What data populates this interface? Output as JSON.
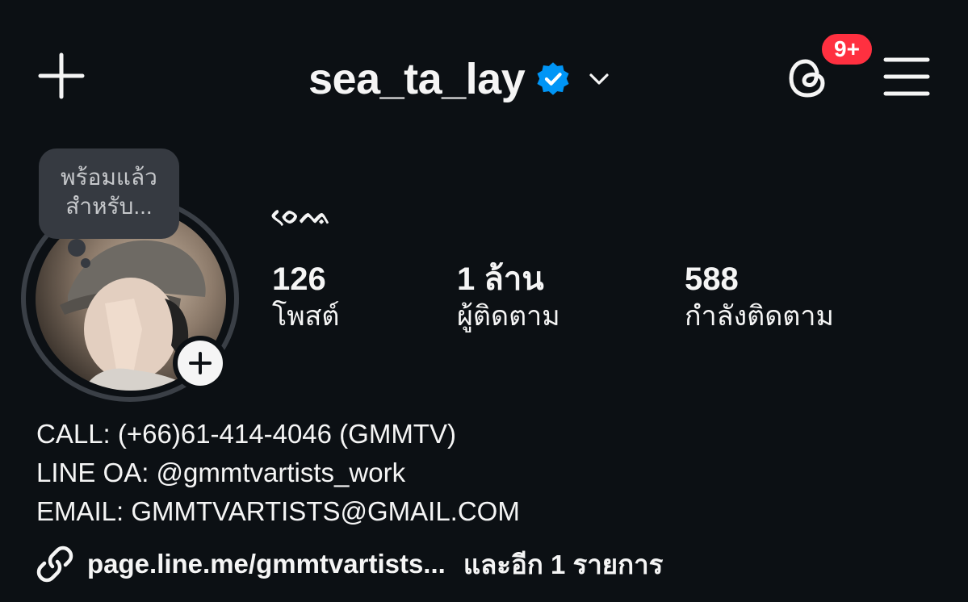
{
  "header": {
    "username": "sea_ta_lay",
    "notification_badge": "9+",
    "icons": [
      "plus-icon",
      "verified-badge-icon",
      "chevron-down-icon",
      "threads-icon",
      "hamburger-menu-icon"
    ]
  },
  "profile": {
    "note": "พร้อมแล้ว\nสำหรับ...",
    "display_name": "ᨔᨙᨕ",
    "stats": {
      "posts": {
        "value": "126",
        "label": "โพสต์"
      },
      "followers": {
        "value": "1 ล้าน",
        "label": "ผู้ติดตาม"
      },
      "following": {
        "value": "588",
        "label": "กำลังติดตาม"
      }
    },
    "bio": [
      "CALL: (+66)61-414-4046 (GMMTV)",
      "LINE OA: @gmmtvartists_work",
      "EMAIL: GMMTVARTISTS@GMAIL.COM"
    ],
    "link": {
      "text": "page.line.me/gmmtvartists...",
      "more": "และอีก 1 รายการ"
    }
  },
  "colors": {
    "background": "#0c1014",
    "text": "#f5f5f5",
    "badge": "#ff3040",
    "verified": "#0095f6",
    "note_bubble": "#363a41"
  }
}
